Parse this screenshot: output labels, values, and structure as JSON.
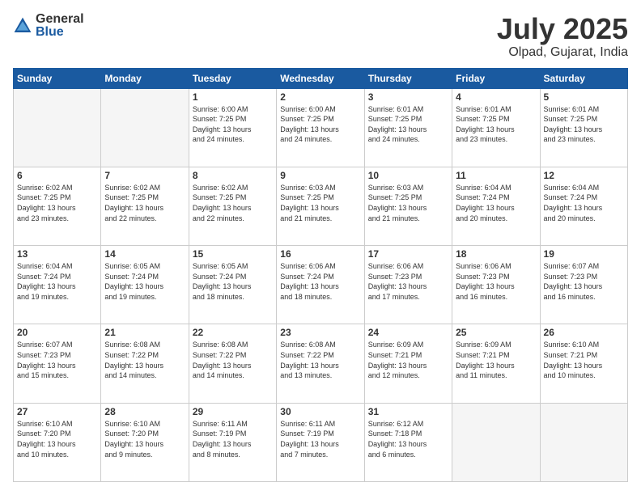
{
  "header": {
    "logo_general": "General",
    "logo_blue": "Blue",
    "month_title": "July 2025",
    "location": "Olpad, Gujarat, India"
  },
  "weekdays": [
    "Sunday",
    "Monday",
    "Tuesday",
    "Wednesday",
    "Thursday",
    "Friday",
    "Saturday"
  ],
  "weeks": [
    [
      {
        "day": "",
        "info": ""
      },
      {
        "day": "",
        "info": ""
      },
      {
        "day": "1",
        "info": "Sunrise: 6:00 AM\nSunset: 7:25 PM\nDaylight: 13 hours\nand 24 minutes."
      },
      {
        "day": "2",
        "info": "Sunrise: 6:00 AM\nSunset: 7:25 PM\nDaylight: 13 hours\nand 24 minutes."
      },
      {
        "day": "3",
        "info": "Sunrise: 6:01 AM\nSunset: 7:25 PM\nDaylight: 13 hours\nand 24 minutes."
      },
      {
        "day": "4",
        "info": "Sunrise: 6:01 AM\nSunset: 7:25 PM\nDaylight: 13 hours\nand 23 minutes."
      },
      {
        "day": "5",
        "info": "Sunrise: 6:01 AM\nSunset: 7:25 PM\nDaylight: 13 hours\nand 23 minutes."
      }
    ],
    [
      {
        "day": "6",
        "info": "Sunrise: 6:02 AM\nSunset: 7:25 PM\nDaylight: 13 hours\nand 23 minutes."
      },
      {
        "day": "7",
        "info": "Sunrise: 6:02 AM\nSunset: 7:25 PM\nDaylight: 13 hours\nand 22 minutes."
      },
      {
        "day": "8",
        "info": "Sunrise: 6:02 AM\nSunset: 7:25 PM\nDaylight: 13 hours\nand 22 minutes."
      },
      {
        "day": "9",
        "info": "Sunrise: 6:03 AM\nSunset: 7:25 PM\nDaylight: 13 hours\nand 21 minutes."
      },
      {
        "day": "10",
        "info": "Sunrise: 6:03 AM\nSunset: 7:25 PM\nDaylight: 13 hours\nand 21 minutes."
      },
      {
        "day": "11",
        "info": "Sunrise: 6:04 AM\nSunset: 7:24 PM\nDaylight: 13 hours\nand 20 minutes."
      },
      {
        "day": "12",
        "info": "Sunrise: 6:04 AM\nSunset: 7:24 PM\nDaylight: 13 hours\nand 20 minutes."
      }
    ],
    [
      {
        "day": "13",
        "info": "Sunrise: 6:04 AM\nSunset: 7:24 PM\nDaylight: 13 hours\nand 19 minutes."
      },
      {
        "day": "14",
        "info": "Sunrise: 6:05 AM\nSunset: 7:24 PM\nDaylight: 13 hours\nand 19 minutes."
      },
      {
        "day": "15",
        "info": "Sunrise: 6:05 AM\nSunset: 7:24 PM\nDaylight: 13 hours\nand 18 minutes."
      },
      {
        "day": "16",
        "info": "Sunrise: 6:06 AM\nSunset: 7:24 PM\nDaylight: 13 hours\nand 18 minutes."
      },
      {
        "day": "17",
        "info": "Sunrise: 6:06 AM\nSunset: 7:23 PM\nDaylight: 13 hours\nand 17 minutes."
      },
      {
        "day": "18",
        "info": "Sunrise: 6:06 AM\nSunset: 7:23 PM\nDaylight: 13 hours\nand 16 minutes."
      },
      {
        "day": "19",
        "info": "Sunrise: 6:07 AM\nSunset: 7:23 PM\nDaylight: 13 hours\nand 16 minutes."
      }
    ],
    [
      {
        "day": "20",
        "info": "Sunrise: 6:07 AM\nSunset: 7:23 PM\nDaylight: 13 hours\nand 15 minutes."
      },
      {
        "day": "21",
        "info": "Sunrise: 6:08 AM\nSunset: 7:22 PM\nDaylight: 13 hours\nand 14 minutes."
      },
      {
        "day": "22",
        "info": "Sunrise: 6:08 AM\nSunset: 7:22 PM\nDaylight: 13 hours\nand 14 minutes."
      },
      {
        "day": "23",
        "info": "Sunrise: 6:08 AM\nSunset: 7:22 PM\nDaylight: 13 hours\nand 13 minutes."
      },
      {
        "day": "24",
        "info": "Sunrise: 6:09 AM\nSunset: 7:21 PM\nDaylight: 13 hours\nand 12 minutes."
      },
      {
        "day": "25",
        "info": "Sunrise: 6:09 AM\nSunset: 7:21 PM\nDaylight: 13 hours\nand 11 minutes."
      },
      {
        "day": "26",
        "info": "Sunrise: 6:10 AM\nSunset: 7:21 PM\nDaylight: 13 hours\nand 10 minutes."
      }
    ],
    [
      {
        "day": "27",
        "info": "Sunrise: 6:10 AM\nSunset: 7:20 PM\nDaylight: 13 hours\nand 10 minutes."
      },
      {
        "day": "28",
        "info": "Sunrise: 6:10 AM\nSunset: 7:20 PM\nDaylight: 13 hours\nand 9 minutes."
      },
      {
        "day": "29",
        "info": "Sunrise: 6:11 AM\nSunset: 7:19 PM\nDaylight: 13 hours\nand 8 minutes."
      },
      {
        "day": "30",
        "info": "Sunrise: 6:11 AM\nSunset: 7:19 PM\nDaylight: 13 hours\nand 7 minutes."
      },
      {
        "day": "31",
        "info": "Sunrise: 6:12 AM\nSunset: 7:18 PM\nDaylight: 13 hours\nand 6 minutes."
      },
      {
        "day": "",
        "info": ""
      },
      {
        "day": "",
        "info": ""
      }
    ]
  ]
}
